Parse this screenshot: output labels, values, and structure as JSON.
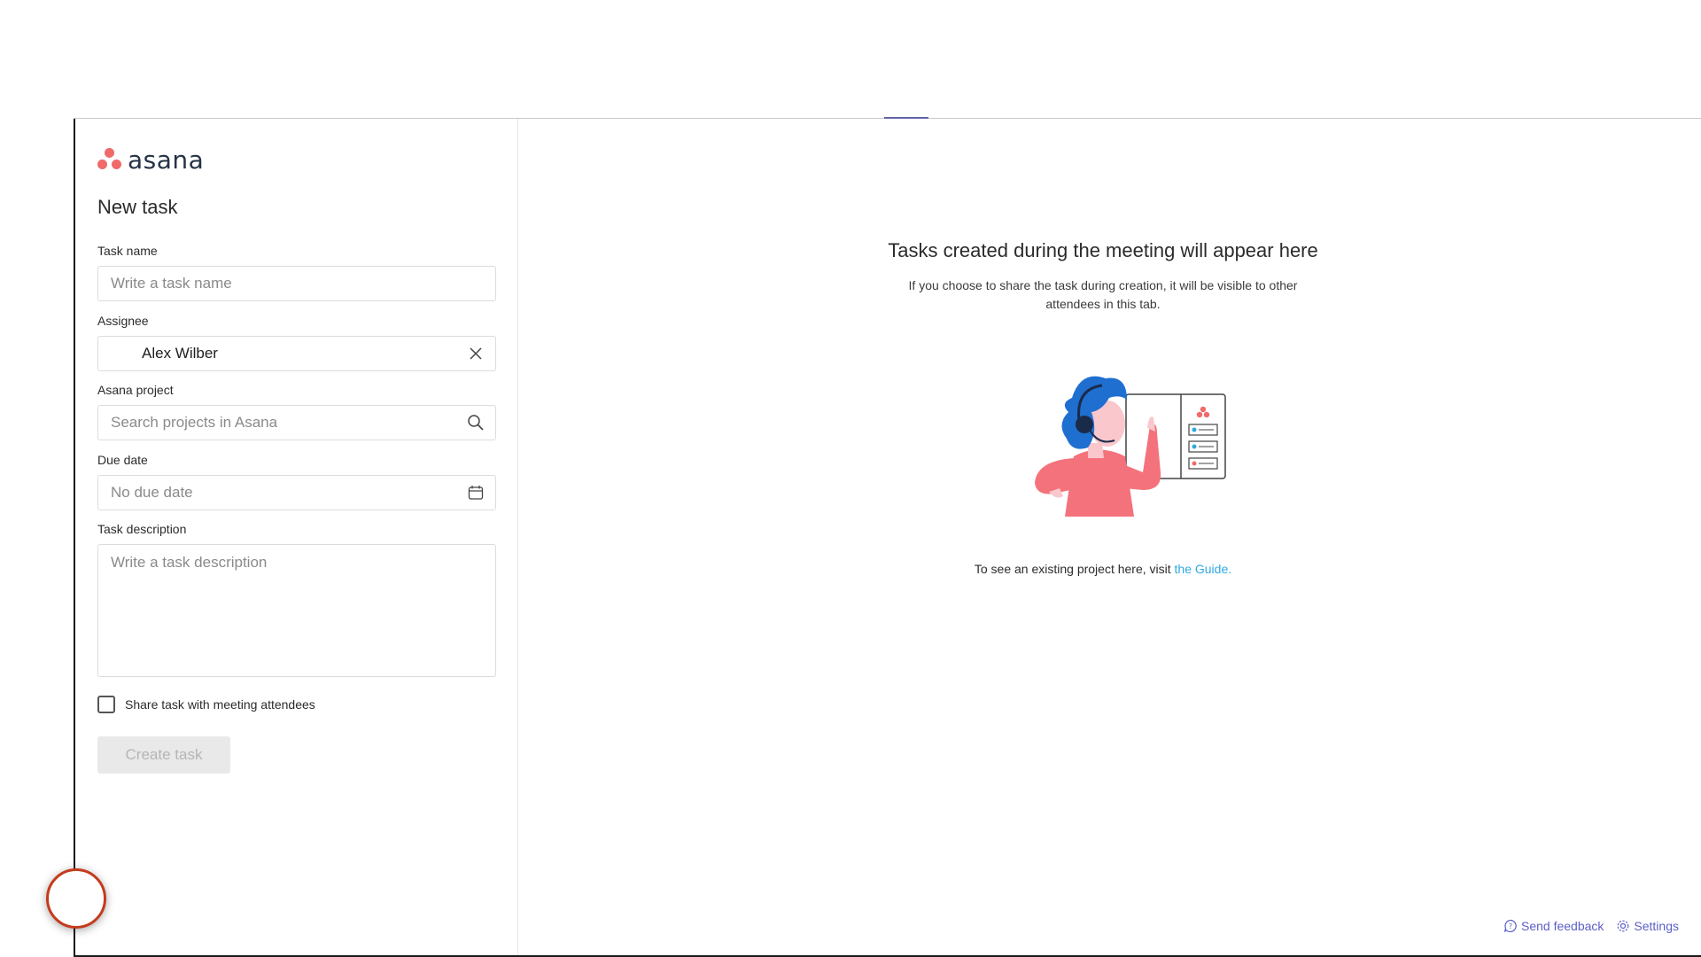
{
  "brand": {
    "name": "asana",
    "dot_color": "#f06a6a",
    "text_color": "#273347"
  },
  "form": {
    "title": "New task",
    "task_name": {
      "label": "Task name",
      "placeholder": "Write a task name"
    },
    "assignee": {
      "label": "Assignee",
      "value": "Alex Wilber",
      "clear_icon": "close-icon"
    },
    "project": {
      "label": "Asana project",
      "placeholder": "Search projects in Asana",
      "icon": "search-icon"
    },
    "due_date": {
      "label": "Due date",
      "placeholder": "No due date",
      "icon": "calendar-icon"
    },
    "description": {
      "label": "Task description",
      "placeholder": "Write a task description"
    },
    "share_checkbox": {
      "label": "Share task with meeting attendees",
      "checked": false
    },
    "submit": {
      "label": "Create task",
      "disabled": true
    }
  },
  "empty_state": {
    "title": "Tasks created during the meeting will appear here",
    "subtitle": "If you choose to share the task during creation, it will be visible to other attendees in this tab.",
    "guide_prefix": "To see an existing project here, visit ",
    "guide_link": "the Guide."
  },
  "footer": {
    "feedback": "Send feedback",
    "settings": "Settings"
  },
  "colors": {
    "accent": "#5b5fc7",
    "link": "#2fa8e0",
    "illustration_hair": "#1f6fd1",
    "illustration_body": "#f4727b"
  }
}
